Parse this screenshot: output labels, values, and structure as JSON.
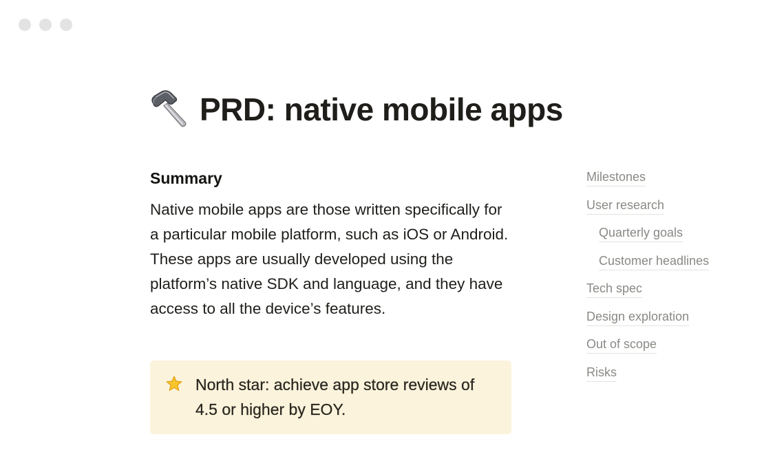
{
  "window": {
    "dots": [
      "close-dot",
      "minimize-dot",
      "maximize-dot"
    ]
  },
  "page": {
    "title": "PRD: native mobile apps",
    "title_icon": "hammer-icon"
  },
  "summary": {
    "heading": "Summary",
    "body": "Native mobile apps are those written specifically for a particular mobile platform, such as iOS or Android. These apps are usually developed using the platform’s native SDK and language, and they have access to all the device’s features."
  },
  "callout": {
    "icon": "star-icon",
    "text": "North star: achieve app store reviews of 4.5 or higher by EOY."
  },
  "toc": {
    "items": [
      {
        "label": "Milestones",
        "level": 0
      },
      {
        "label": "User research",
        "level": 0
      },
      {
        "label": "Quarterly goals",
        "level": 1
      },
      {
        "label": "Customer headlines",
        "level": 1
      },
      {
        "label": "Tech spec",
        "level": 0
      },
      {
        "label": "Design exploration",
        "level": 0
      },
      {
        "label": "Out of scope",
        "level": 0
      },
      {
        "label": "Risks",
        "level": 0
      }
    ]
  },
  "colors": {
    "callout_bg": "#fbf3db",
    "toc_text": "#8a8985",
    "dot": "#e3e3e3"
  }
}
